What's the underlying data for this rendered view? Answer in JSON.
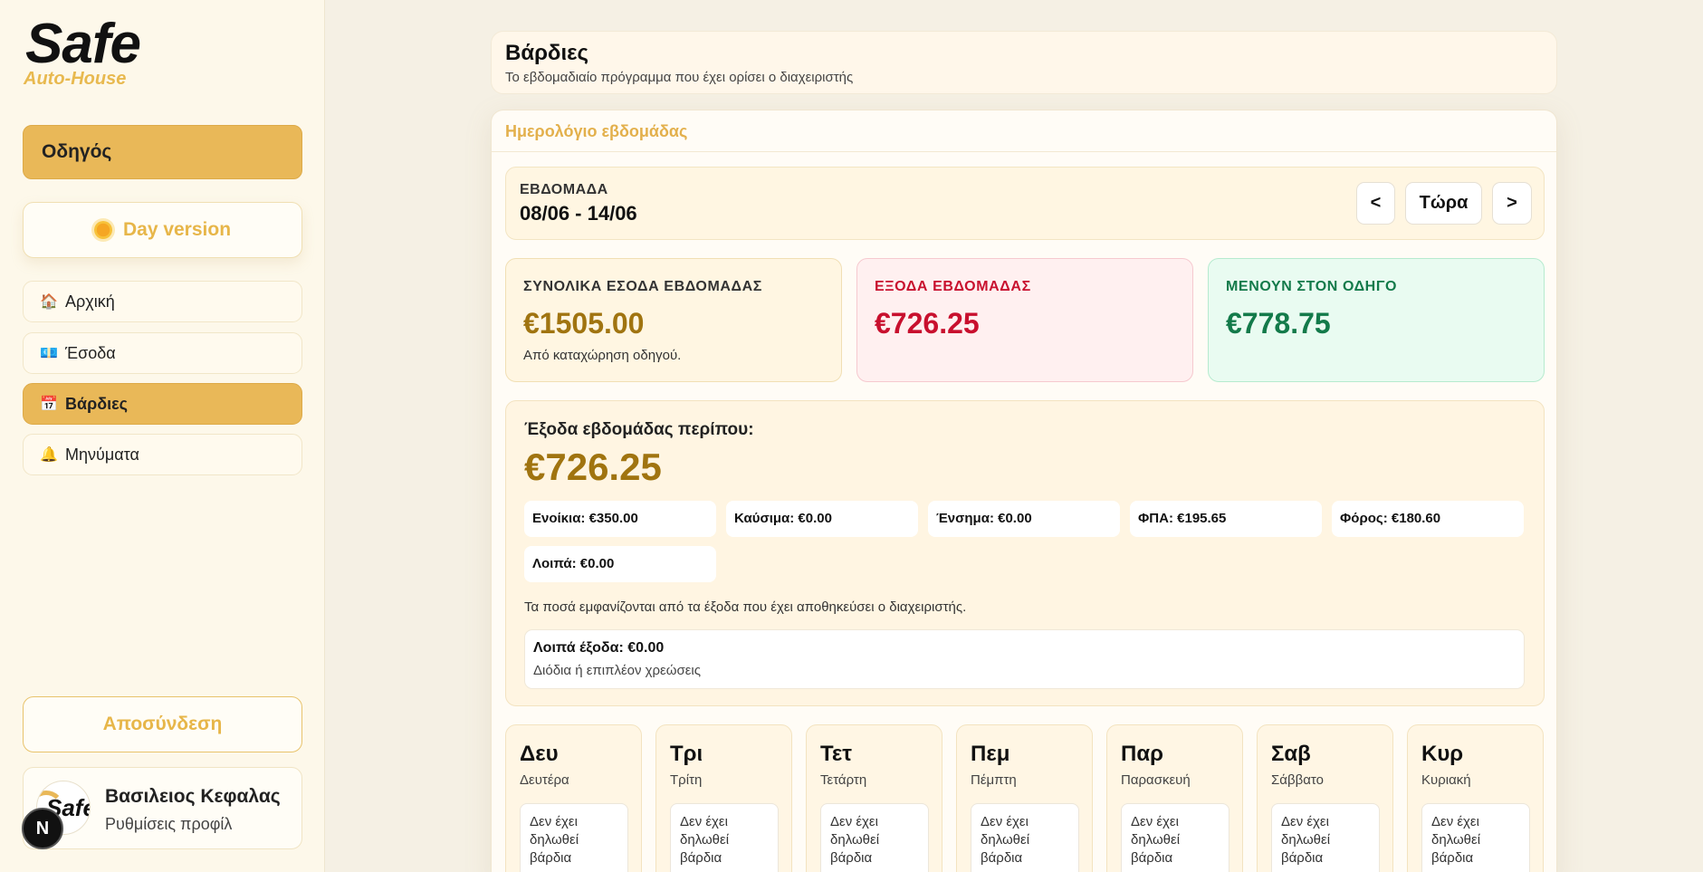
{
  "sidebar": {
    "brand": "Safe",
    "brand_sub": "Auto-House",
    "role": "Οδηγός",
    "day_version": "Day version",
    "nav": [
      {
        "icon": "🏠",
        "label": "Αρχική"
      },
      {
        "icon": "💶",
        "label": "Έσοδα"
      },
      {
        "icon": "📅",
        "label": "Βάρδιες"
      },
      {
        "icon": "🔔",
        "label": "Μηνύματα"
      }
    ],
    "logout": "Αποσύνδεση",
    "profile": {
      "avatar_text": "Safe",
      "name": "Βασιλειος Κεφαλας",
      "settings": "Ρυθμίσεις προφίλ"
    },
    "next_badge": "N"
  },
  "header": {
    "title": "Βάρδιες",
    "subtitle": "Το εβδομαδιαίο πρόγραμμα που έχει ορίσει ο διαχειριστής"
  },
  "calendar": {
    "title": "Ημερολόγιο εβδομάδας",
    "week_label": "ΕΒΔΟΜΑΔΑ",
    "week_range": "08/06 - 14/06",
    "prev": "<",
    "now": "Τώρα",
    "next": ">"
  },
  "stats": {
    "income": {
      "label": "ΣΥΝΟΛΙΚΑ ΕΣΟΔΑ ΕΒΔΟΜΑΔΑΣ",
      "value": "€1505.00",
      "note": "Από καταχώρηση οδηγού."
    },
    "expenses": {
      "label": "ΕΞΟΔΑ ΕΒΔΟΜΑΔΑΣ",
      "value": "€726.25"
    },
    "driver": {
      "label": "ΜΕΝΟΥΝ ΣΤΟΝ ΟΔΗΓΟ",
      "value": "€778.75"
    }
  },
  "expenses": {
    "title": "Έξοδα εβδομάδας περίπου:",
    "value": "€726.25",
    "items": [
      "Ενοίκια: €350.00",
      "Καύσιμα: €0.00",
      "Ένσημα: €0.00",
      "ΦΠΑ: €195.65",
      "Φόρος: €180.60",
      "Λοιπά: €0.00"
    ],
    "note": "Τα ποσά εμφανίζονται από τα έξοδα που έχει αποθηκεύσει ο διαχειριστής.",
    "extra_title": "Λοιπά έξοδα: €0.00",
    "extra_sub": "Διόδια ή επιπλέον χρεώσεις"
  },
  "days": [
    {
      "abbr": "Δευ",
      "full": "Δευτέρα",
      "status": "Δεν έχει δηλωθεί βάρδια"
    },
    {
      "abbr": "Τρι",
      "full": "Τρίτη",
      "status": "Δεν έχει δηλωθεί βάρδια"
    },
    {
      "abbr": "Τετ",
      "full": "Τετάρτη",
      "status": "Δεν έχει δηλωθεί βάρδια"
    },
    {
      "abbr": "Πεμ",
      "full": "Πέμπτη",
      "status": "Δεν έχει δηλωθεί βάρδια"
    },
    {
      "abbr": "Παρ",
      "full": "Παρασκευή",
      "status": "Δεν έχει δηλωθεί βάρδια"
    },
    {
      "abbr": "Σαβ",
      "full": "Σάββατο",
      "status": "Δεν έχει δηλωθεί βάρδια"
    },
    {
      "abbr": "Κυρ",
      "full": "Κυριακή",
      "status": "Δεν έχει δηλωθεί βάρδια"
    }
  ],
  "colors": {
    "accent": "#e9b858",
    "income": "#a07410",
    "expense": "#c8102e",
    "driver": "#137a4a"
  }
}
